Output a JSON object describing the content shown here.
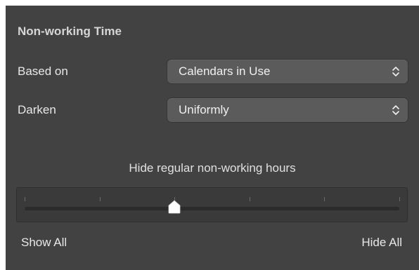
{
  "section": {
    "title": "Non-working Time"
  },
  "based_on": {
    "label": "Based on",
    "value": "Calendars in Use"
  },
  "darken": {
    "label": "Darken",
    "value": "Uniformly"
  },
  "slider": {
    "caption": "Hide regular non-working hours",
    "min_label": "Show All",
    "max_label": "Hide All",
    "tick_count": 6,
    "position_fraction": 0.4
  },
  "icons": {
    "popup_arrows": "up-down-chevrons-icon",
    "slider_thumb": "pentagon-thumb-icon"
  },
  "colors": {
    "panel_bg": "#424242",
    "popup_bg": "#5b5b5b",
    "text": "#e8e8e8"
  }
}
